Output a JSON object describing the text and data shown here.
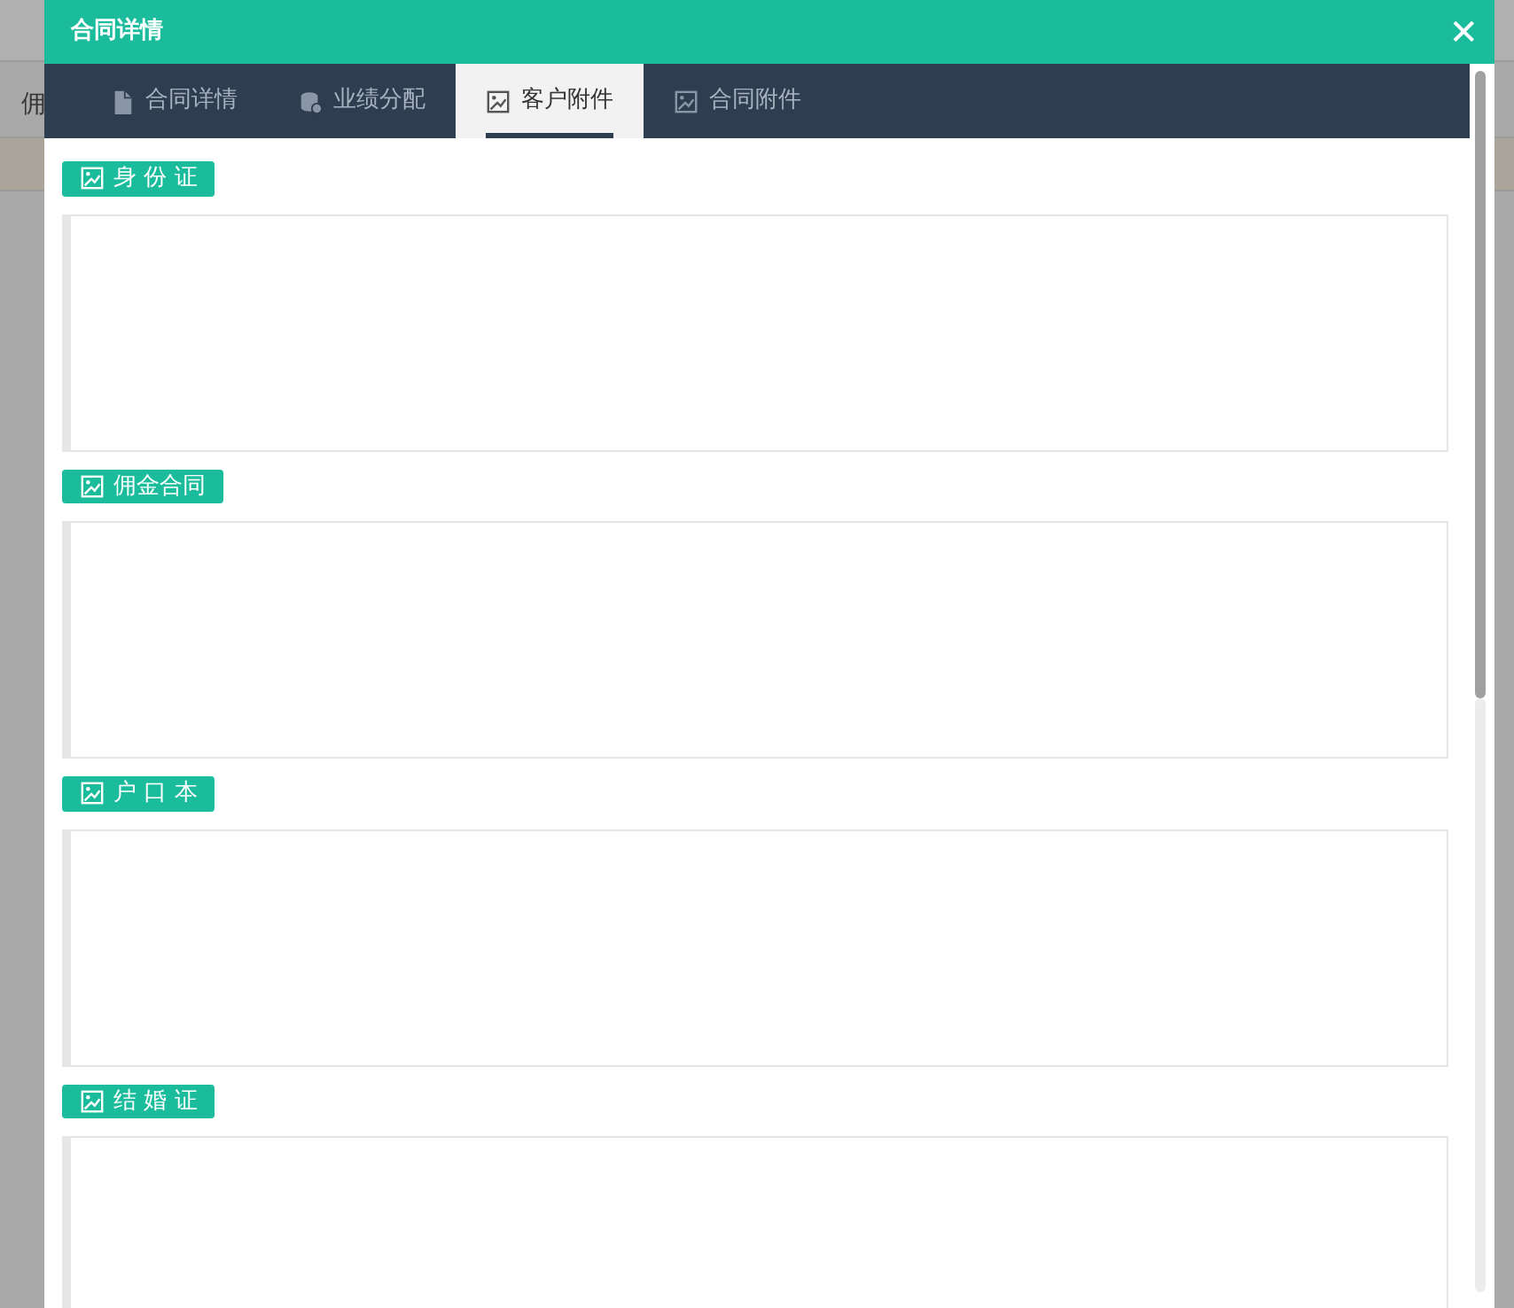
{
  "background_page": {
    "cut_label": "佣"
  },
  "dialog": {
    "title": "合同详情",
    "close_glyph": "✕"
  },
  "tabs": [
    {
      "label": "合同详情",
      "kind": "document",
      "selected": false
    },
    {
      "label": "业绩分配",
      "kind": "database",
      "selected": false
    },
    {
      "label": "客户附件",
      "kind": "image",
      "selected": true
    },
    {
      "label": "合同附件",
      "kind": "image",
      "selected": false
    }
  ],
  "attachment_groups": [
    {
      "label": "身 份 证"
    },
    {
      "label": "佣金合同"
    },
    {
      "label": "户 口 本"
    },
    {
      "label": "结 婚 证"
    }
  ]
}
